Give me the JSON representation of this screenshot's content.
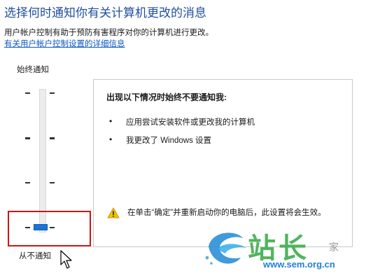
{
  "header": {
    "title": "选择何时通知你有关计算机更改的消息",
    "description": "用户帐户控制有助于预防有害程序对你的计算机进行更改。",
    "link": "有关用户帐户控制设置的详细信息"
  },
  "slider": {
    "top_label": "始终通知",
    "bottom_label": "从不通知",
    "level": 0,
    "levels": 4
  },
  "panel": {
    "heading": "出现以下情况时始终不要通知我:",
    "items": [
      {
        "bullet": "•",
        "text": "应用尝试安装软件或更改我的计算机"
      },
      {
        "bullet": "•",
        "text": "我更改了 Windows 设置"
      }
    ],
    "warning": "在单击“确定”并重新启动你的电脑后，此设置将会生效。"
  },
  "watermark": {
    "text": "站长",
    "url": "www.sem.org.cn",
    "side": "家"
  },
  "colors": {
    "accent": "#1a75d6",
    "highlight": "#d11414",
    "title": "#1f4e9e"
  }
}
